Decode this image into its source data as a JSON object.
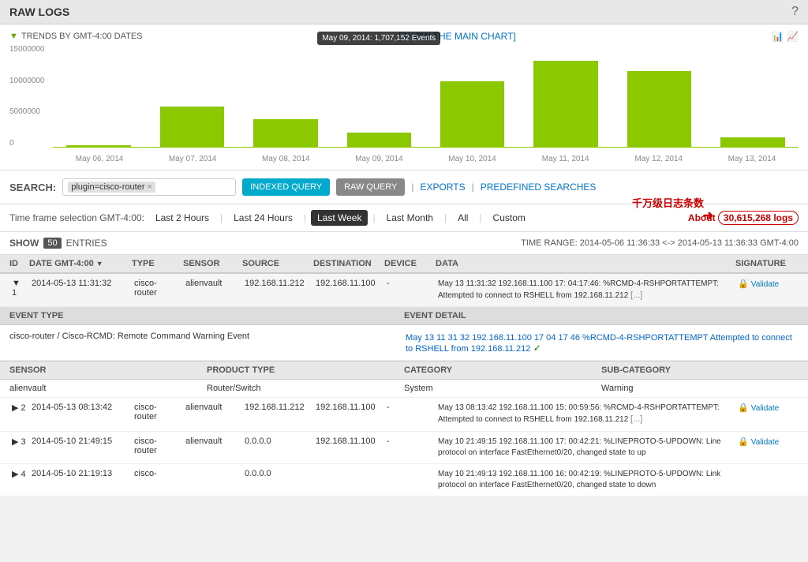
{
  "header": {
    "title": "RAW LOGS",
    "help_icon": "?"
  },
  "chart": {
    "trends_label": "TRENDS BY GMT-4:00 DATES",
    "show_main_chart": "[SHOW THE MAIN CHART]",
    "y_labels": [
      "15000000",
      "10000000",
      "5000000",
      "0"
    ],
    "bars": [
      {
        "date": "May 06, 2014",
        "height_pct": 2,
        "value": 0
      },
      {
        "date": "May 07, 2014",
        "height_pct": 40,
        "value": 5000000
      },
      {
        "date": "May 08, 2014",
        "height_pct": 28,
        "value": 3500000
      },
      {
        "date": "May 09, 2014",
        "height_pct": 15,
        "value": 1707152,
        "tooltip": "May 09, 2014: 1,707,152 Events",
        "has_tooltip": true
      },
      {
        "date": "May 10, 2014",
        "height_pct": 65,
        "value": 9000000
      },
      {
        "date": "May 11, 2014",
        "height_pct": 85,
        "value": 13000000
      },
      {
        "date": "May 12, 2014",
        "height_pct": 75,
        "value": 11000000
      },
      {
        "date": "May 13, 2014",
        "height_pct": 10,
        "value": 1500000
      }
    ],
    "x_labels": [
      "May 06, 2014",
      "May 07, 2014",
      "May 08, 2014",
      "May 09, 2014",
      "May 10, 2014",
      "May 11, 2014",
      "May 12, 2014",
      "May 13, 2014"
    ]
  },
  "search": {
    "label": "SEARCH:",
    "tag": "plugin=cisco-router",
    "tag_x": "×",
    "btn_indexed": "INDEXED QUERY",
    "btn_raw": "RAW QUERY",
    "exports": "EXPORTS",
    "predefined": "PREDEFINED SEARCHES",
    "divider": "|"
  },
  "timeframe": {
    "label": "Time frame selection GMT-4:00:",
    "options": [
      "Last 2 Hours",
      "Last 24 Hours",
      "Last Week",
      "Last Month",
      "All",
      "Custom"
    ],
    "active": "Last Week",
    "log_count_prefix": "About",
    "log_count": "30,615,268",
    "log_count_suffix": "logs",
    "annotation_chinese": "千万级日志条数"
  },
  "entries": {
    "show_label": "SHOW",
    "count": "50",
    "entries_label": "ENTRIES",
    "time_range": "TIME RANGE: 2014-05-06 11:36:33 <-> 2014-05-13 11:36:33 GMT-4:00"
  },
  "table": {
    "columns": [
      "ID",
      "DATE GMT-4:00 ▼",
      "TYPE",
      "SENSOR",
      "SOURCE",
      "DESTINATION",
      "DEVICE",
      "DATA",
      "SIGNATURE"
    ],
    "rows": [
      {
        "id": "1",
        "date": "2014-05-13 11:31:32",
        "type": "cisco-\nrouter",
        "sensor": "alienvault",
        "source": "192.168.11.212",
        "destination": "192.168.11.100",
        "device": "-",
        "data": "May 13 11:31:32 192.168.11.100 17: 04:17:46: %RCMD-4-RSHPORTATTEMPT: Attempted to connect to RSHELL from 192.168.11.212",
        "signature": "Validate",
        "expanded": true
      },
      {
        "id": "2",
        "date": "2014-05-13 08:13:42",
        "type": "cisco-\nrouter",
        "sensor": "alienvault",
        "source": "192.168.11.212",
        "destination": "192.168.11.100",
        "device": "-",
        "data": "May 13 08:13:42 192.168.11.100 15: 00:59:56: %RCMD-4-RSHPORTATTEMPT: Attempted to connect to RSHELL from 192.168.11.212",
        "signature": "Validate",
        "expanded": false
      },
      {
        "id": "3",
        "date": "2014-05-10 21:49:15",
        "type": "cisco-\nrouter",
        "sensor": "alienvault",
        "source": "0.0.0.0",
        "destination": "192.168.11.100",
        "device": "-",
        "data": "May 10 21:49:15 192.168.11.100 17: 00:42:21: %LINEPROTO-5-UPDOWN: Line protocol on interface FastEthernet0/20, changed state to up",
        "signature": "Validate",
        "expanded": false
      },
      {
        "id": "4",
        "date": "2014-05-10 21:19:13",
        "type": "cisco-",
        "sensor": "",
        "source": "0.0.0.0",
        "destination": "",
        "device": "",
        "data": "May 10 21:49:13 192.168.11.100 16: 00:42:19: %LINEPROTO-5-UPDOWN: Link protocol on interface FastEthernet0/20, changed state to down",
        "signature": "",
        "expanded": false
      }
    ],
    "expanded_row": {
      "event_type_header": "EVENT TYPE",
      "event_detail_header": "EVENT DETAIL",
      "event_type_val": "cisco-router / Cisco-RCMD: Remote Command Warning Event",
      "event_detail_val": "May 13 11 31 32 192.168.11.100 17 04 17 46 %RCMD-4-RSHPORTATTEMPT Attempted to connect to RSHELL from 192.168.11.212",
      "checkmark": "✓",
      "sensor_header": [
        "SENSOR",
        "PRODUCT TYPE",
        "CATEGORY",
        "SUB-CATEGORY"
      ],
      "sensor_row": [
        "alienvault",
        "Router/Switch",
        "System",
        "Warning"
      ]
    }
  }
}
